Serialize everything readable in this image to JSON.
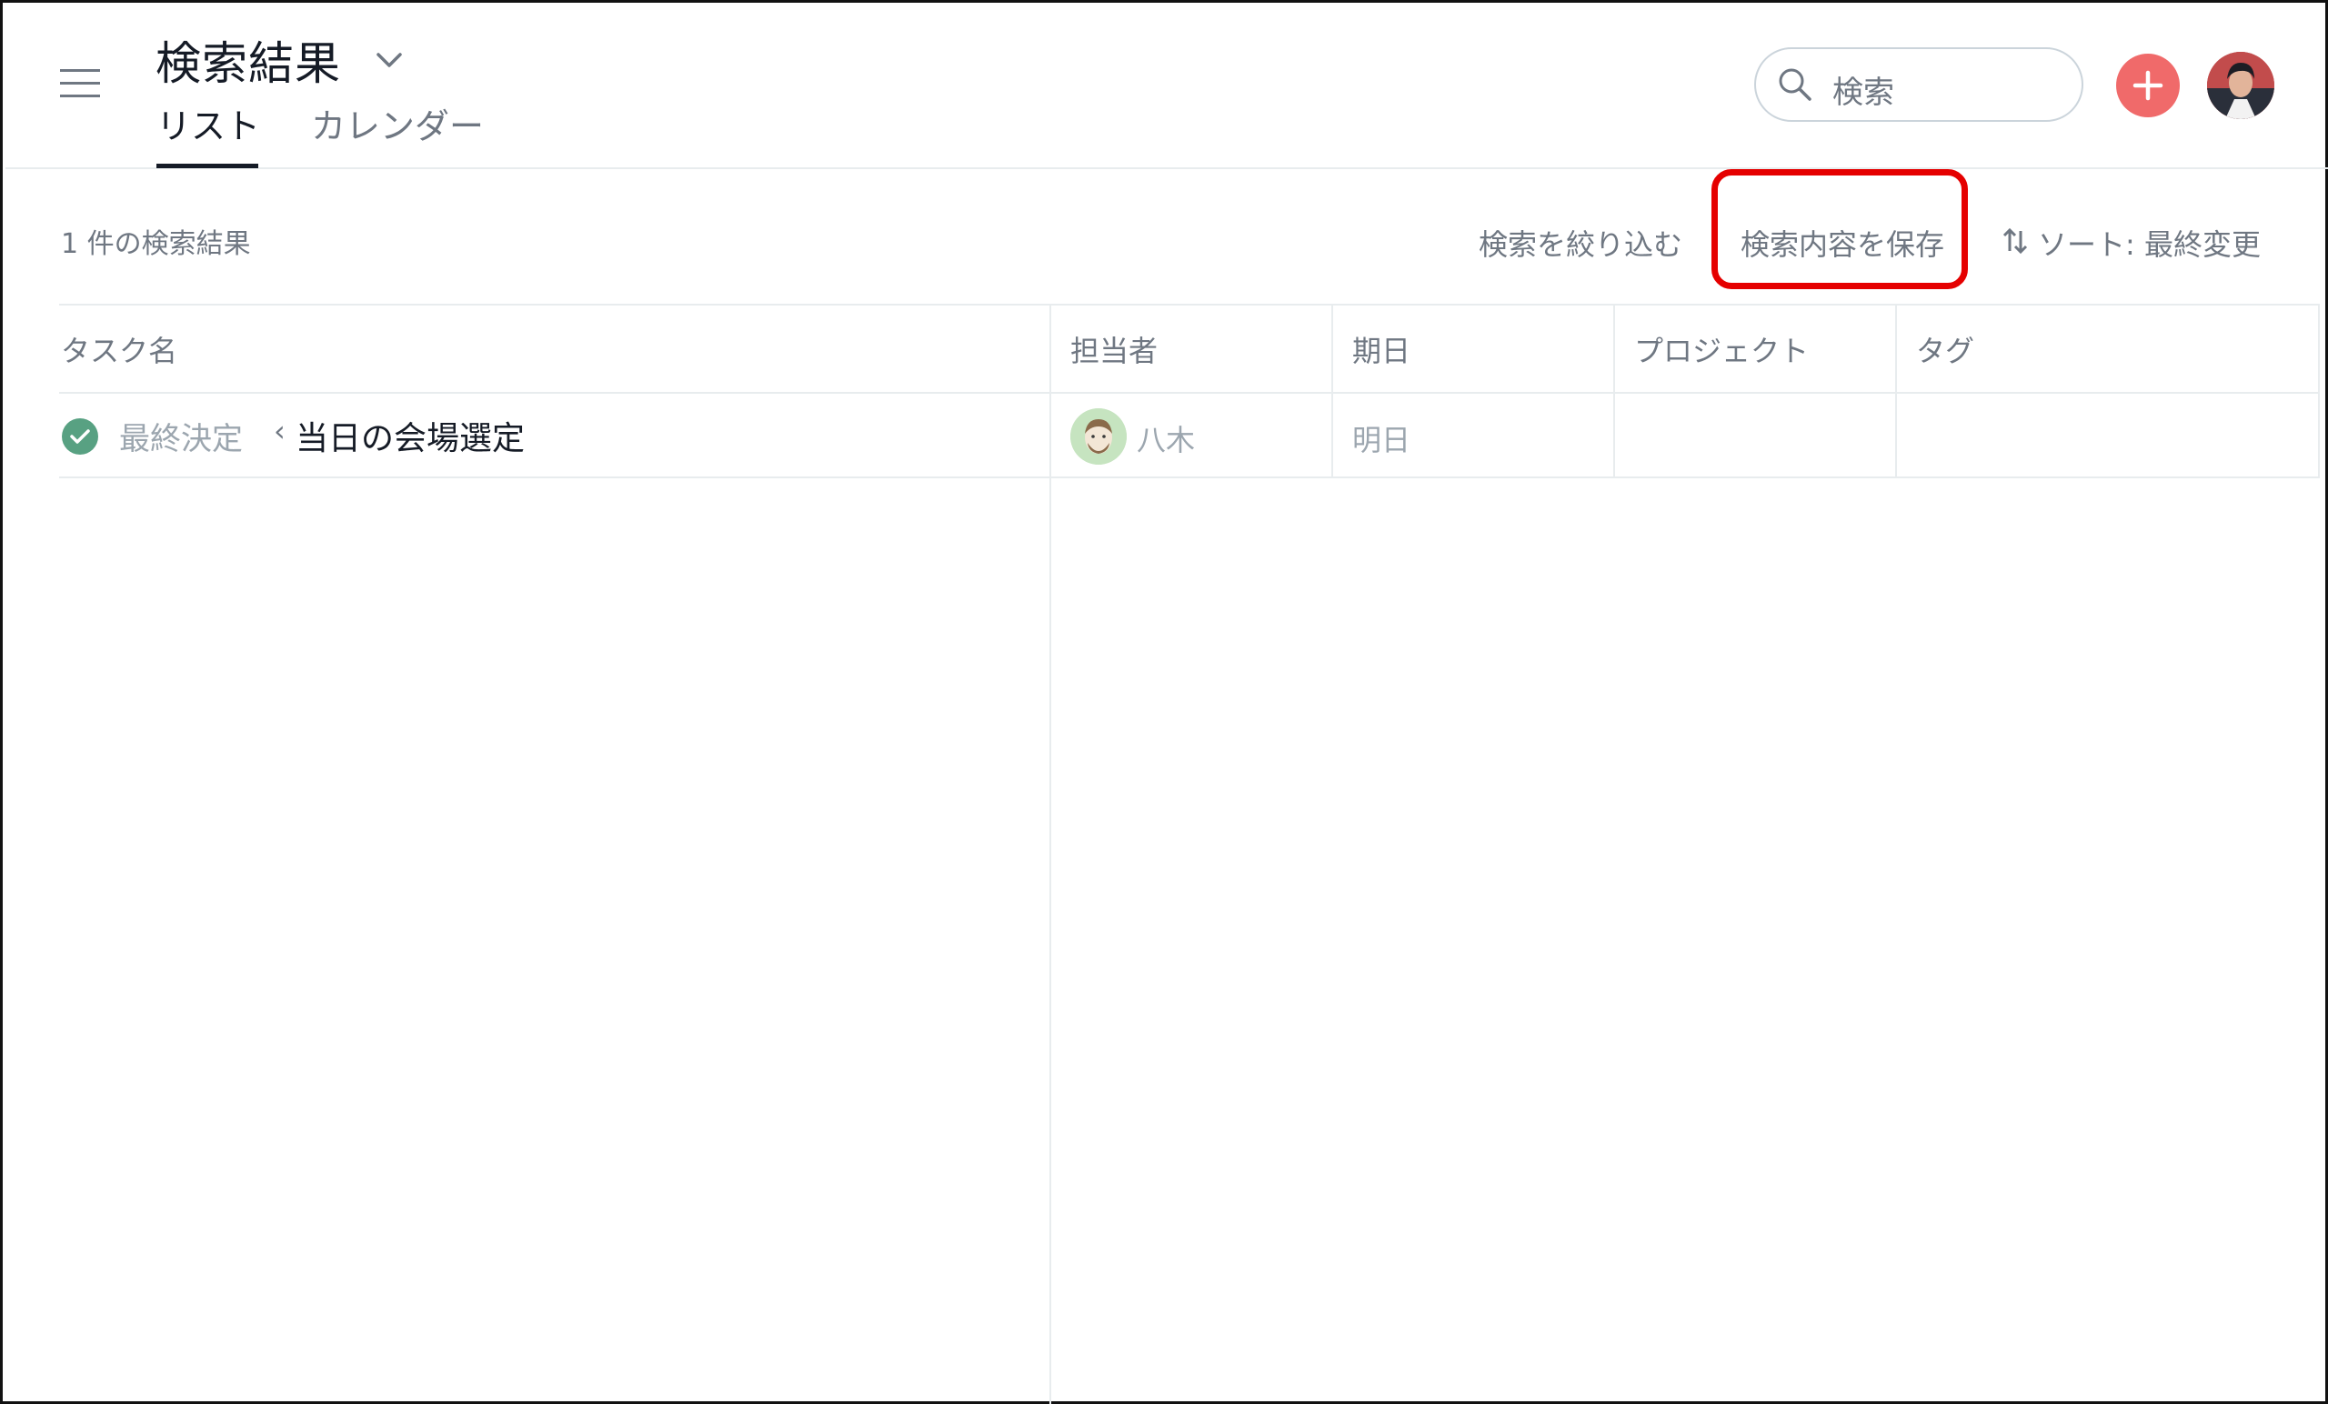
{
  "header": {
    "title": "検索結果",
    "tabs": [
      {
        "label": "リスト",
        "active": true
      },
      {
        "label": "カレンダー",
        "active": false
      }
    ],
    "search": {
      "placeholder": "検索"
    },
    "icons": {
      "menu": "hamburger-icon",
      "title_dropdown": "chevron-down-icon",
      "search": "search-icon",
      "add": "plus-icon",
      "avatar": "user-avatar"
    },
    "add_button_color": "#f06a6a"
  },
  "toolbar": {
    "result_count": "1 件の検索結果",
    "refine_label": "検索を絞り込む",
    "save_label": "検索内容を保存",
    "sort_label": "ソート: 最終変更",
    "highlight_color": "#e50000"
  },
  "table": {
    "columns": [
      "タスク名",
      "担当者",
      "期日",
      "プロジェクト",
      "タグ"
    ],
    "rows": [
      {
        "completed": true,
        "parent": "最終決定",
        "separator": "‹",
        "name": "当日の会場選定",
        "assignee": "八木",
        "due": "明日",
        "project": "",
        "tags": ""
      }
    ],
    "complete_color": "#58a182"
  }
}
